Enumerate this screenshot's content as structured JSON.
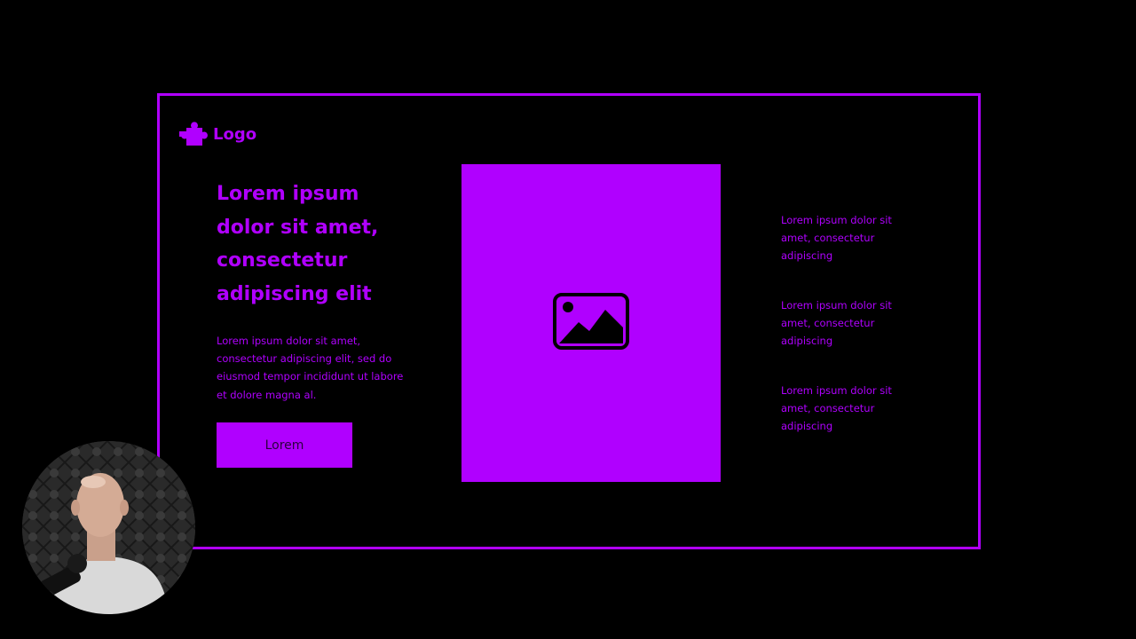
{
  "logo": {
    "text": "Logo",
    "icon": "puzzle-icon"
  },
  "hero": {
    "headline": "Lorem ipsum dolor sit amet, consectetur adipiscing elit",
    "paragraph": "Lorem ipsum dolor sit amet, consectetur adipiscing elit, sed do eiusmod tempor incididunt ut labore et dolore magna al.",
    "button_label": "Lorem"
  },
  "image_placeholder": {
    "icon": "image-icon"
  },
  "features": [
    {
      "text": "Lorem ipsum dolor sit amet, consectetur adipiscing"
    },
    {
      "text": "Lorem ipsum dolor sit amet, consectetur adipiscing"
    },
    {
      "text": "Lorem ipsum dolor sit amet, consectetur adipiscing"
    }
  ],
  "colors": {
    "background": "#000000",
    "accent": "#b000ff",
    "button_text": "#2a003d"
  }
}
